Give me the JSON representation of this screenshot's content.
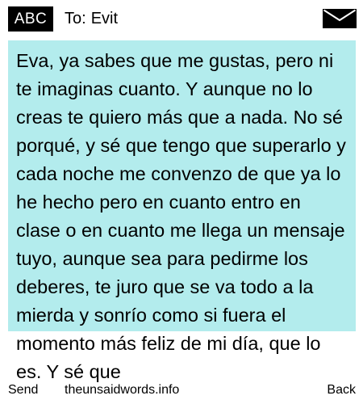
{
  "header": {
    "input_mode": "ABC",
    "to_label": "To:",
    "recipient": "Evit",
    "envelope_icon": "envelope-icon"
  },
  "message": {
    "body": "Eva, ya sabes que me gustas, pero ni te imaginas cuanto. Y aunque no lo creas te quiero más que a nada. No sé porqué, y sé que tengo que superarlo y cada noche me convenzo de que ya lo he hecho pero en cuanto entro en clase o en cuanto me llega un mensaje tuyo, aunque sea para pedirme los deberes, te juro que se va todo a la mierda y sonrío como si fuera el momento más feliz de mi día, que lo es. Y sé que",
    "background_color": "#b3eced"
  },
  "footer": {
    "send_label": "Send",
    "site_label": "theunsaidwords.info",
    "back_label": "Back"
  }
}
